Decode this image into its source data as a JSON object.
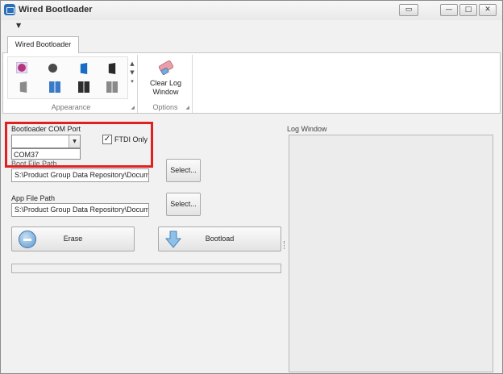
{
  "window": {
    "title": "Wired Bootloader",
    "controls": {
      "minimize": "—",
      "maximize": "□",
      "close": "✕",
      "extra": "▭"
    }
  },
  "quick_access": {
    "dropdown_glyph": "▼"
  },
  "ribbon": {
    "tab_label": "Wired Bootloader",
    "groups": {
      "appearance": {
        "label": "Appearance",
        "gallery_icons": [
          "circle-pink-icon",
          "circle-dark-icon",
          "office-blue-icon",
          "office-dark-icon",
          "office-gray-icon",
          "tiles-blue-icon",
          "tiles-dark-icon",
          "tiles-gray-icon"
        ],
        "scroll_up": "▲",
        "scroll_down": "▼",
        "more": "▾"
      },
      "options": {
        "label": "Options",
        "clear_log_line1": "Clear Log",
        "clear_log_line2": "Window"
      }
    },
    "launcher_glyph": "◢"
  },
  "bootloader": {
    "com_port_label": "Bootloader COM Port",
    "com_port_value": "",
    "com_port_option": "COM37",
    "dropdown_glyph": "▼",
    "ftdi_only_label": "FTDI Only",
    "ftdi_only_checked": true,
    "check_glyph": "✓",
    "boot_file_path_label": "Boot File Path",
    "boot_file_path_value": "S:\\Product Group Data Repository\\Docum",
    "app_file_path_label": "App File Path",
    "app_file_path_value": "S:\\Product Group Data Repository\\Docum",
    "select_label": "Select...",
    "erase_label": "Erase",
    "bootload_label": "Bootload",
    "progress": 0
  },
  "log": {
    "title": "Log Window",
    "content": ""
  },
  "colors": {
    "highlight": "#e02121",
    "accent": "#2a6fb8"
  }
}
